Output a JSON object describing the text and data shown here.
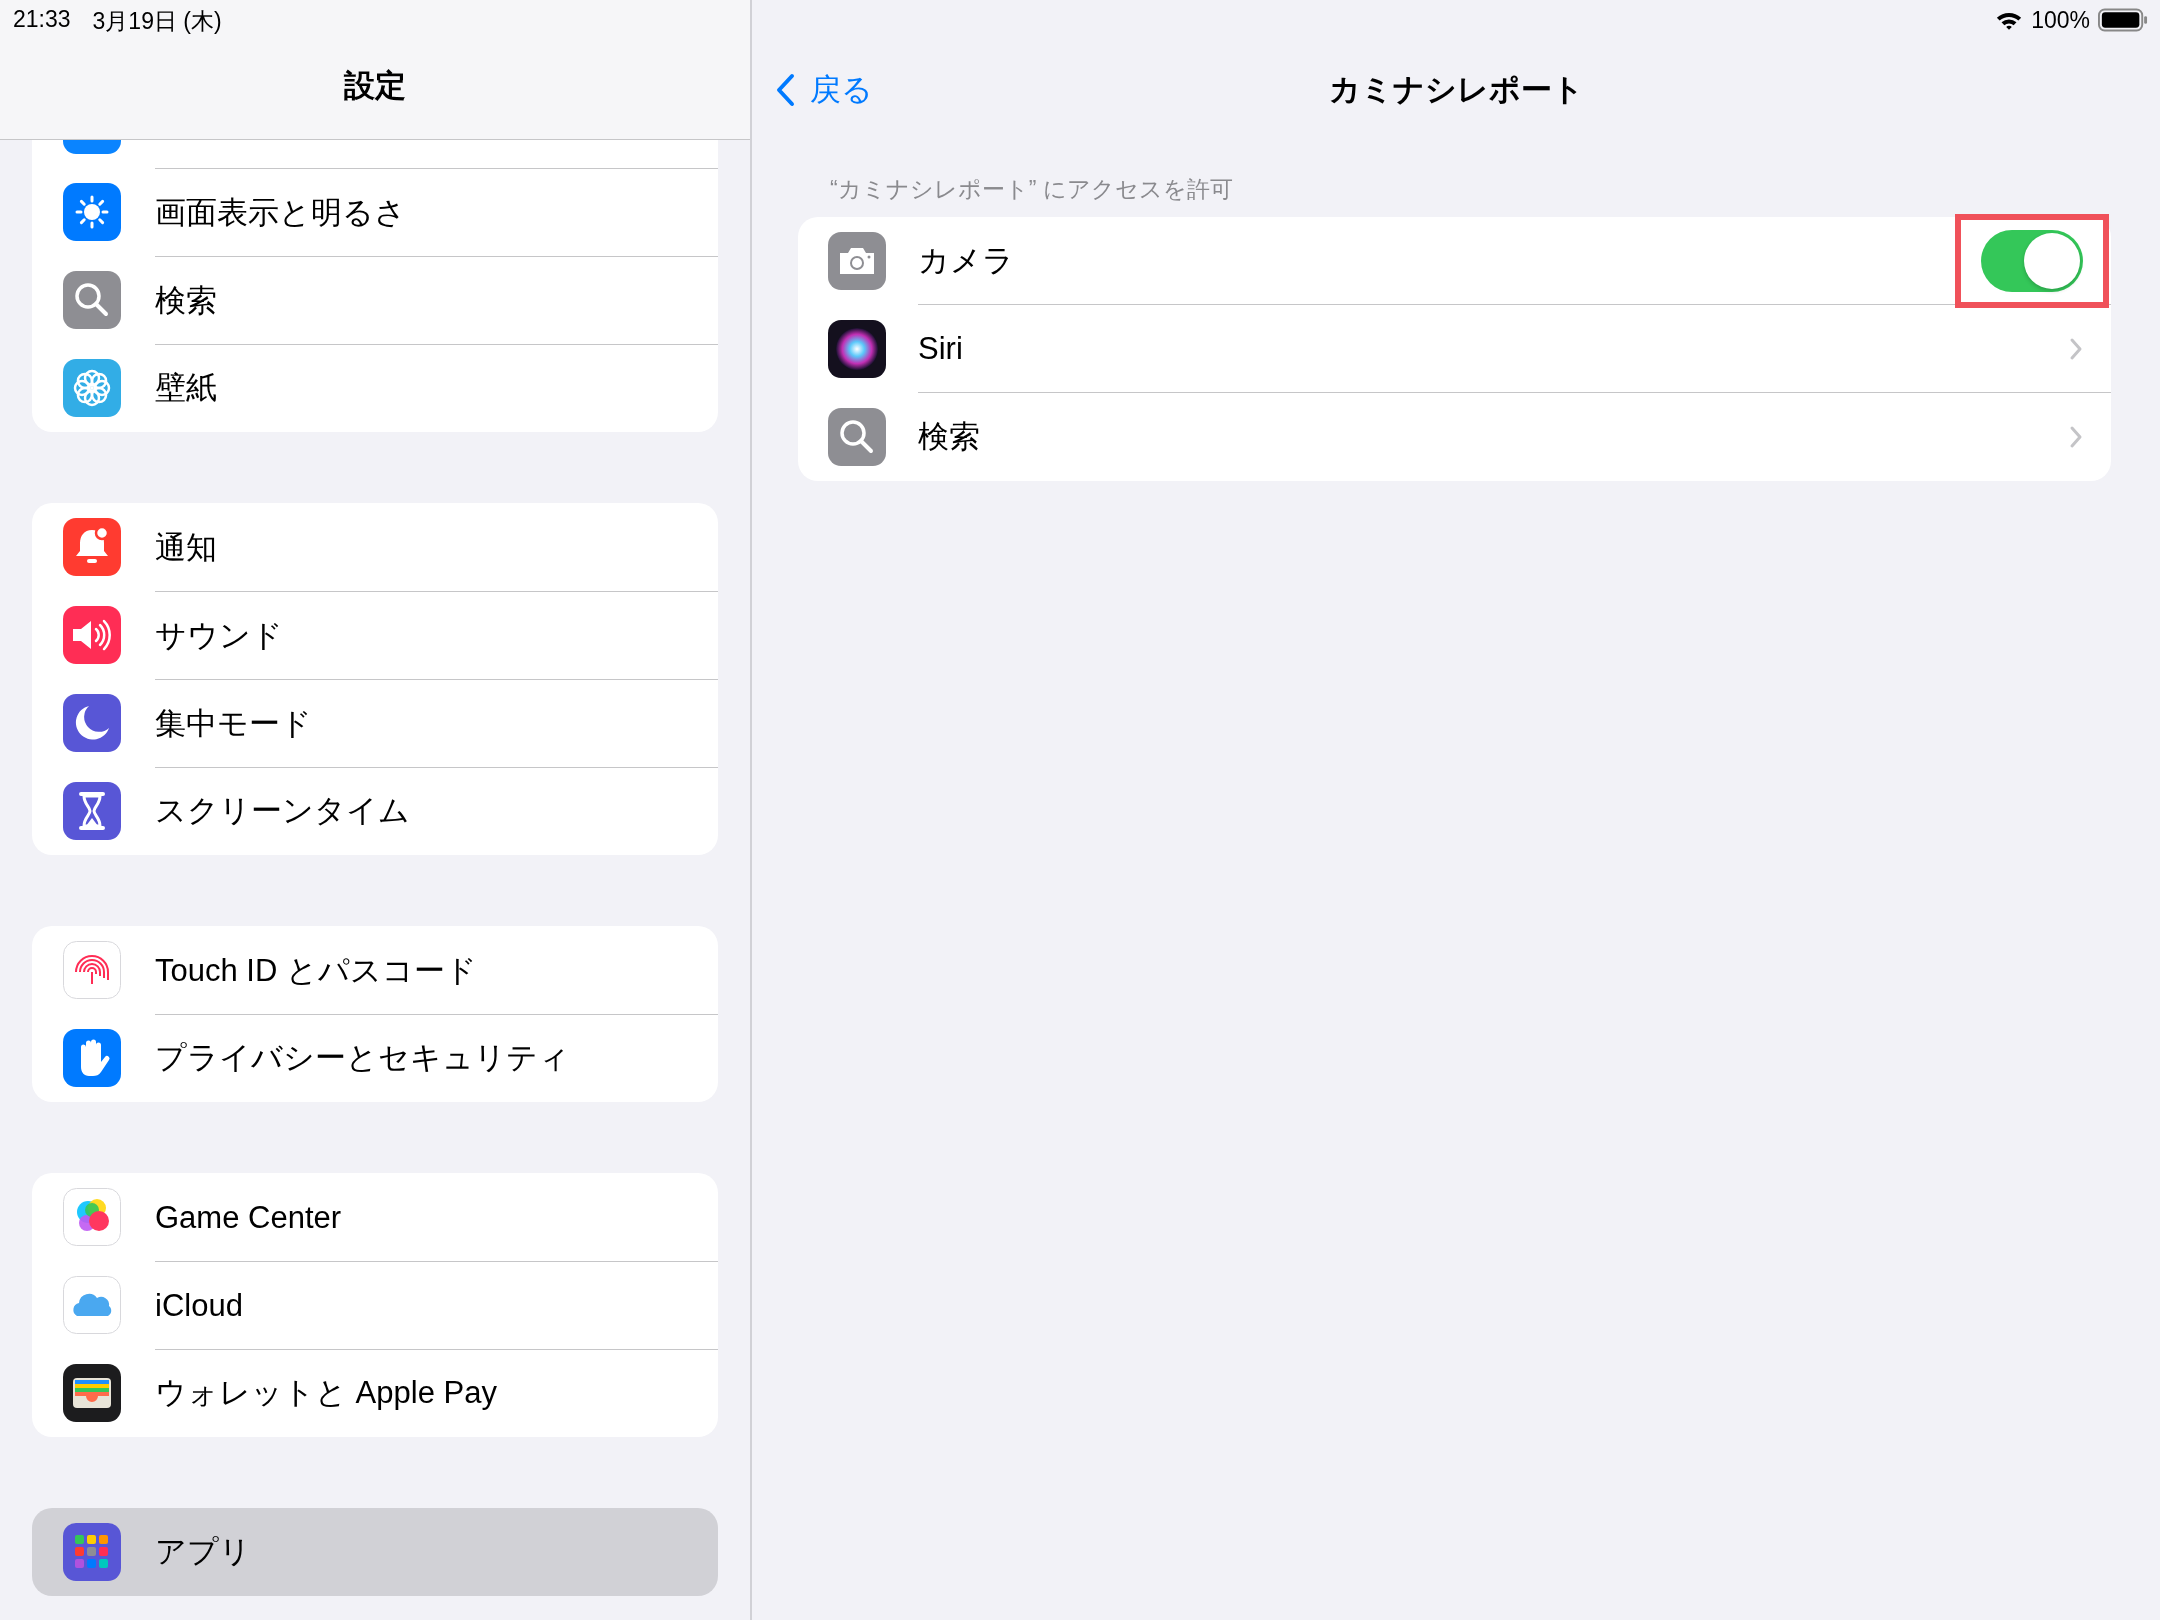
{
  "status_bar": {
    "time": "21:33",
    "date": "3月19日 (木)",
    "battery": "100%"
  },
  "sidebar": {
    "title": "設定",
    "groups": [
      {
        "items": [
          {
            "selected": false
          },
          {
            "label": "画面表示と明るさ",
            "selected": false
          },
          {
            "label": "検索",
            "selected": false
          },
          {
            "label": "壁紙",
            "selected": false
          }
        ]
      },
      {
        "items": [
          {
            "label": "通知",
            "selected": false
          },
          {
            "label": "サウンド",
            "selected": false
          },
          {
            "label": "集中モード",
            "selected": false
          },
          {
            "label": "スクリーンタイム",
            "selected": false
          }
        ]
      },
      {
        "items": [
          {
            "label": "Touch ID とパスコード",
            "selected": false
          },
          {
            "label": "プライバシーとセキュリティ",
            "selected": false
          }
        ]
      },
      {
        "items": [
          {
            "label": "Game Center",
            "selected": false
          },
          {
            "label": "iCloud",
            "selected": false
          },
          {
            "label": "ウォレットと Apple Pay",
            "selected": false
          }
        ]
      },
      {
        "items": [
          {
            "label": "アプリ",
            "selected": true
          }
        ]
      }
    ]
  },
  "detail": {
    "back": "戻る",
    "title": "カミナシレポート",
    "section_header": "“カミナシレポート” にアクセスを許可",
    "rows": [
      {
        "kind": "toggle",
        "label": "カメラ",
        "on": true,
        "highlighted": true
      },
      {
        "kind": "link",
        "label": "Siri"
      },
      {
        "kind": "link",
        "label": "検索"
      }
    ]
  }
}
